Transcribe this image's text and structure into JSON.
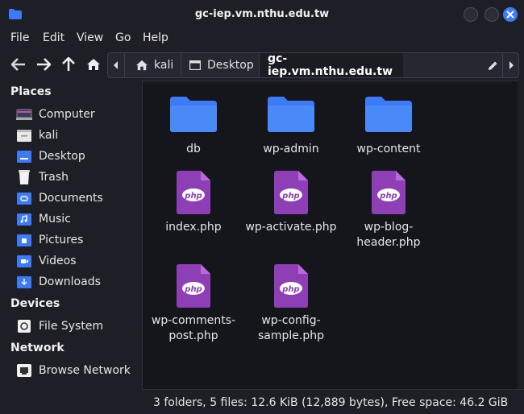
{
  "window": {
    "title": "gc-iep.vm.nthu.edu.tw"
  },
  "menu": [
    "File",
    "Edit",
    "View",
    "Go",
    "Help"
  ],
  "pathbar": {
    "crumbs": [
      "kali",
      "Desktop",
      "gc-iep.vm.nthu.edu.tw"
    ]
  },
  "sidebar": {
    "places_label": "Places",
    "places": [
      {
        "label": "Computer",
        "icon": "computer-icon"
      },
      {
        "label": "kali",
        "icon": "home-folder-icon"
      },
      {
        "label": "Desktop",
        "icon": "desktop-folder-icon"
      },
      {
        "label": "Trash",
        "icon": "trash-icon"
      },
      {
        "label": "Documents",
        "icon": "documents-folder-icon"
      },
      {
        "label": "Music",
        "icon": "music-folder-icon"
      },
      {
        "label": "Pictures",
        "icon": "pictures-folder-icon"
      },
      {
        "label": "Videos",
        "icon": "videos-folder-icon"
      },
      {
        "label": "Downloads",
        "icon": "downloads-folder-icon"
      }
    ],
    "devices_label": "Devices",
    "devices": [
      {
        "label": "File System",
        "icon": "drive-icon"
      }
    ],
    "network_label": "Network",
    "network": [
      {
        "label": "Browse Network",
        "icon": "network-icon"
      }
    ]
  },
  "files": [
    {
      "name": "db",
      "type": "folder"
    },
    {
      "name": "wp-admin",
      "type": "folder"
    },
    {
      "name": "wp-content",
      "type": "folder"
    },
    {
      "name": "index.php",
      "type": "php"
    },
    {
      "name": "wp-activate.php",
      "type": "php"
    },
    {
      "name": "wp-blog-header.php",
      "type": "php"
    },
    {
      "name": "wp-comments-post.php",
      "type": "php"
    },
    {
      "name": "wp-config-sample.php",
      "type": "php"
    }
  ],
  "file_lines": {
    "f0": [
      "db"
    ],
    "f1": [
      "wp-admin"
    ],
    "f2": [
      "wp-content"
    ],
    "f3": [
      "index.php"
    ],
    "f4": [
      "wp-activate.php"
    ],
    "f5": [
      "wp-blog-",
      "header.php"
    ],
    "f6": [
      "wp-comments-",
      "post.php"
    ],
    "f7": [
      "wp-config-",
      "sample.php"
    ]
  },
  "status": "3 folders, 5 files: 12.6 KiB (12,889 bytes), Free space: 46.2 GiB",
  "colors": {
    "accent": "#3d7bf6",
    "folder": "#3d7bf6",
    "php": "#8e3fb5"
  }
}
